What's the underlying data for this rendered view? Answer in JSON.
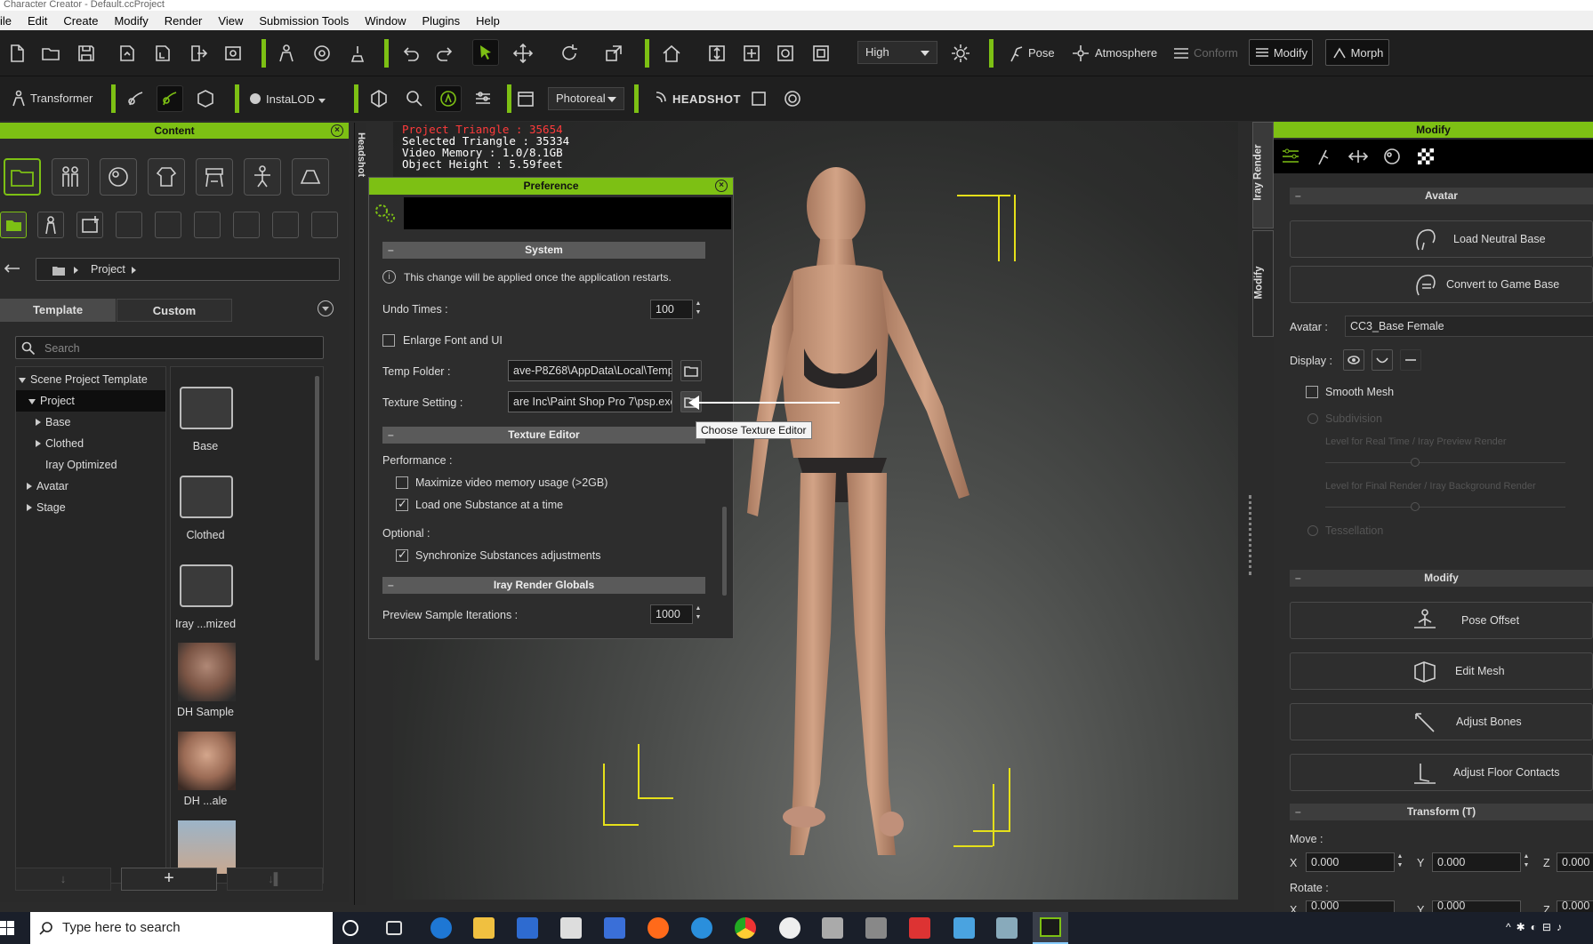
{
  "window": {
    "title": "Character Creator - Default.ccProject"
  },
  "menu": [
    "ile",
    "Edit",
    "Create",
    "Modify",
    "Render",
    "View",
    "Submission Tools",
    "Window",
    "Plugins",
    "Help"
  ],
  "toolbar": {
    "quality": "High",
    "pose_label": "Pose",
    "atmosphere_label": "Atmosphere",
    "conform_label": "Conform",
    "modify_label": "Modify",
    "morph_label": "Morph",
    "transformer_label": "Transformer",
    "instalod_label": "InstaLOD",
    "render_mode": "Photoreal",
    "headshot_label": "HEADSHOT"
  },
  "content": {
    "title": "Content",
    "breadcrumb": "Project",
    "tab_template": "Template",
    "tab_custom": "Custom",
    "search_placeholder": "Search",
    "tree": [
      {
        "label": "Scene Project Template",
        "expanded": true
      },
      {
        "label": "Project",
        "expanded": true
      },
      {
        "label": "Base"
      },
      {
        "label": "Clothed"
      },
      {
        "label": "Iray Optimized"
      },
      {
        "label": "Avatar"
      },
      {
        "label": "Stage"
      }
    ],
    "items": [
      "Base",
      "Clothed",
      "Iray ...mized",
      "DH Sample",
      "DH ...ale"
    ]
  },
  "stats": {
    "line1": "Project Triangle : 35654",
    "line2": "Selected Triangle : 35334",
    "line3": "Video Memory : 1.0/8.1GB",
    "line4": "Object Height : 5.59feet"
  },
  "preference": {
    "title": "Preference",
    "system_header": "System",
    "restart_note": "This change will be applied once the application restarts.",
    "undo_label": "Undo Times :",
    "undo_value": "100",
    "enlarge_label": "Enlarge Font and UI",
    "temp_label": "Temp Folder :",
    "temp_value": "ave-P8Z68\\AppData\\Local\\Temp\\",
    "texture_label": "Texture Setting :",
    "texture_value": "are Inc\\Paint Shop Pro 7\\psp.exe",
    "texture_editor_header": "Texture Editor",
    "performance_label": "Performance :",
    "maxvideo_label": "Maximize video memory usage (>2GB)",
    "loadone_label": "Load one Substance at a time",
    "optional_label": "Optional :",
    "sync_label": "Synchronize Substances adjustments",
    "iray_header": "Iray Render Globals",
    "preview_label": "Preview Sample Iterations :",
    "preview_value": "1000",
    "tooltip": "Choose Texture Editor"
  },
  "side_tabs": {
    "iray": "Iray Render",
    "modify": "Modify",
    "headshot": "Headshot"
  },
  "modify_panel": {
    "title": "Modify",
    "avatar_header": "Avatar",
    "load_neutral": "Load Neutral Base",
    "convert_game": "Convert to Game Base",
    "avatar_label": "Avatar :",
    "avatar_value": "CC3_Base Female",
    "display_label": "Display :",
    "smooth_mesh": "Smooth Mesh",
    "subdivision": "Subdivision",
    "level_realtime": "Level for Real Time / Iray Preview Render",
    "level_final": "Level for Final Render / Iray Background Render",
    "tessellation": "Tessellation",
    "modify_header": "Modify",
    "pose_offset": "Pose Offset",
    "edit_mesh": "Edit Mesh",
    "adjust_bones": "Adjust Bones",
    "adjust_floor": "Adjust Floor Contacts",
    "transform_header": "Transform  (T)",
    "move_label": "Move :",
    "rotate_label": "Rotate :",
    "x_label": "X",
    "y_label": "Y",
    "z_label": "Z",
    "move_x": "0.000",
    "move_y": "0.000",
    "move_z": "0.000",
    "rot_x": "0.000",
    "rot_y": "0.000",
    "rot_z": "0.000"
  },
  "taskbar": {
    "search_text": "Type here to search"
  },
  "colors": {
    "accent": "#7dc014",
    "stats_red": "#ff3b3b",
    "guide_yellow": "#e5e01a"
  }
}
